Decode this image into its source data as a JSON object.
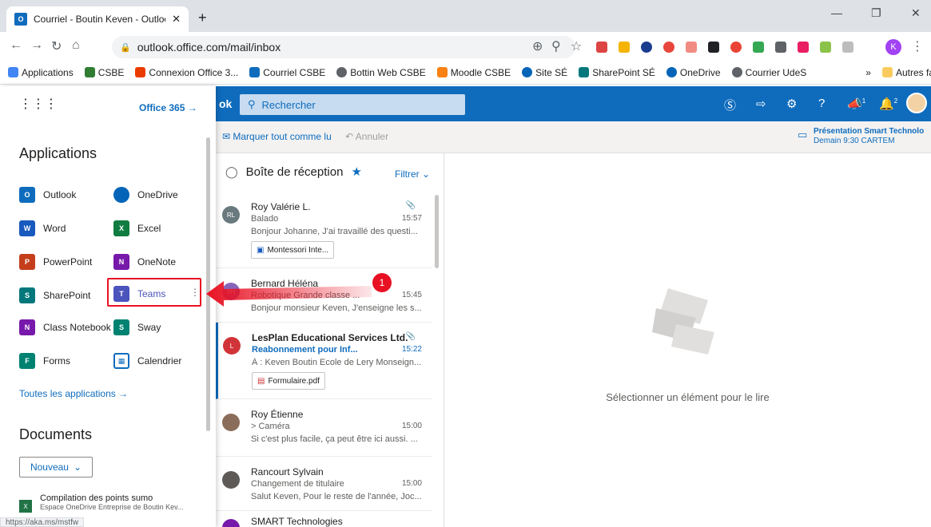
{
  "browser": {
    "tab_title": "Courriel - Boutin Keven - Outlook",
    "url": "outlook.office.com/mail/inbox",
    "profile_initial": "K",
    "bookmarks": [
      "Applications",
      "CSBE",
      "Connexion Office 3...",
      "Courriel CSBE",
      "Bottin Web CSBE",
      "Moodle CSBE",
      "Site SÉ",
      "SharePoint SÉ",
      "OneDrive",
      "Courrier UdeS"
    ],
    "other_bookmarks": "Autres favoris",
    "status_url": "https://aka.ms/mstfw"
  },
  "header": {
    "search_placeholder": "Rechercher",
    "notif_count_1": "1",
    "notif_count_2": "2",
    "app_label": "ok"
  },
  "commands": {
    "mark_all_read": "Marquer tout comme lu",
    "undo": "Annuler"
  },
  "event": {
    "title": "Présentation Smart Technolo",
    "when": "Demain 9:30 CARTEM"
  },
  "inbox": {
    "title": "Boîte de réception",
    "filter": "Filtrer",
    "messages": [
      {
        "initials": "RL",
        "from": "Roy Valérie L.",
        "subject": "Balado",
        "time": "15:57",
        "preview": "Bonjour Johanne, J'ai travaillé des questi...",
        "attachment": "Montessori Inte..."
      },
      {
        "initials": "BH",
        "from": "Bernard Héléna",
        "subject": "Robotique Grande classe ...",
        "time": "15:45",
        "preview": "Bonjour monsieur Keven, J'enseigne les s..."
      },
      {
        "initials": "L",
        "from": "LesPlan Educational Services Ltd.",
        "subject": "Reabonnement pour Inf...",
        "time": "15:22",
        "preview": "À : Keven Boutin Ecole de Lery Monseign...",
        "attachment": "Formulaire.pdf"
      },
      {
        "initials": "",
        "from": "Roy Étienne",
        "subject": "> Caméra",
        "time": "15:00",
        "preview": "Si c'est plus facile, ça peut être ici aussi. ..."
      },
      {
        "initials": "",
        "from": "Rancourt Sylvain",
        "subject": "Changement de titulaire",
        "time": "15:00",
        "preview": "Salut Keven, Pour le reste de l'année, Joc..."
      },
      {
        "initials": "",
        "from": "SMART Technologies",
        "subject": "",
        "time": "",
        "preview": ""
      }
    ]
  },
  "reading": {
    "empty_text": "Sélectionner un élément pour le lire"
  },
  "launcher": {
    "office_link": "Office 365",
    "apps_title": "Applications",
    "apps": [
      {
        "label": "Outlook",
        "abbr": "O",
        "color": "#0f6cbd"
      },
      {
        "label": "OneDrive",
        "abbr": "",
        "color": "#0364b8"
      },
      {
        "label": "Word",
        "abbr": "W",
        "color": "#185abd"
      },
      {
        "label": "Excel",
        "abbr": "X",
        "color": "#107c41"
      },
      {
        "label": "PowerPoint",
        "abbr": "P",
        "color": "#c43e1c"
      },
      {
        "label": "OneNote",
        "abbr": "N",
        "color": "#7719aa"
      },
      {
        "label": "SharePoint",
        "abbr": "S",
        "color": "#03787c"
      },
      {
        "label": "Teams",
        "abbr": "T",
        "color": "#4b53bc"
      },
      {
        "label": "Class Notebook",
        "abbr": "N",
        "color": "#7719aa"
      },
      {
        "label": "Sway",
        "abbr": "S",
        "color": "#008272"
      },
      {
        "label": "Forms",
        "abbr": "F",
        "color": "#008272"
      },
      {
        "label": "Calendrier",
        "abbr": "",
        "color": "#0f6cbd"
      }
    ],
    "all_apps": "Toutes les applications",
    "docs_title": "Documents",
    "new_button": "Nouveau",
    "doc_name": "Compilation des points sumo",
    "doc_location": "Espace OneDrive Entreprise de Boutin Kev..."
  },
  "annotation": {
    "step": "1"
  }
}
